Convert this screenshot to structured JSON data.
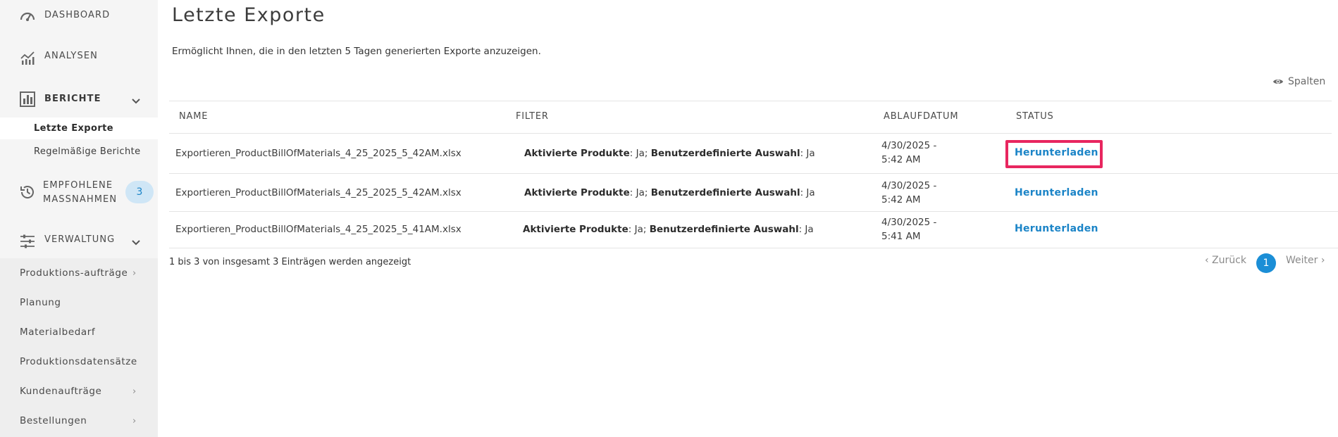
{
  "sidebar": {
    "dashboard": "DASHBOARD",
    "analysen": "ANALYSEN",
    "berichte": "BERICHTE",
    "berichte_sub": [
      "Letzte Exporte",
      "Regelmäßige Berichte"
    ],
    "empfohlene_line1": "EMPFOHLENE",
    "empfohlene_line2": "MASSNAHMEN",
    "empfohlene_badge": "3",
    "verwaltung": "VERWALTUNG",
    "lower_items": [
      {
        "label": "Produktions-aufträge",
        "chevron": "›"
      },
      {
        "label": "Planung",
        "chevron": ""
      },
      {
        "label": "Materialbedarf",
        "chevron": ""
      },
      {
        "label": "Produktionsdatensätze",
        "chevron": ""
      },
      {
        "label": "Kundenaufträge",
        "chevron": "›"
      },
      {
        "label": "Bestellungen",
        "chevron": "›"
      }
    ]
  },
  "main": {
    "title": "Letzte Exporte",
    "description": "Ermöglicht Ihnen, die in den letzten 5 Tagen generierten Exporte anzuzeigen.",
    "columns_button": "Spalten",
    "table": {
      "headers": [
        "NAME",
        "FILTER",
        "ABLAUFDATUM",
        "STATUS"
      ],
      "filter_label_1": "Aktivierte Produkte",
      "filter_value_1": ": Ja; ",
      "filter_label_2": "Benutzerdefinierte Auswahl",
      "filter_value_2": ": Ja",
      "rows": [
        {
          "name": "Exportieren_ProductBillOfMaterials_4_25_2025_5_42AM.xlsx",
          "date_line1": "4/30/2025 -",
          "date_line2": "5:42 AM",
          "status": "Herunterladen"
        },
        {
          "name": "Exportieren_ProductBillOfMaterials_4_25_2025_5_42AM.xlsx",
          "date_line1": "4/30/2025 -",
          "date_line2": "5:42 AM",
          "status": "Herunterladen"
        },
        {
          "name": "Exportieren_ProductBillOfMaterials_4_25_2025_5_41AM.xlsx",
          "date_line1": "4/30/2025 -",
          "date_line2": "5:41 AM",
          "status": "Herunterladen"
        }
      ]
    },
    "footer_info": "1 bis 3 von insgesamt 3 Einträgen werden angezeigt",
    "pagination": {
      "prev": "‹ Zurück",
      "current": "1",
      "next": "Weiter ›"
    }
  },
  "colors": {
    "accent": "#1b84c7",
    "highlight": "#e8265f",
    "sidebar_bg": "#f5f5f5"
  }
}
